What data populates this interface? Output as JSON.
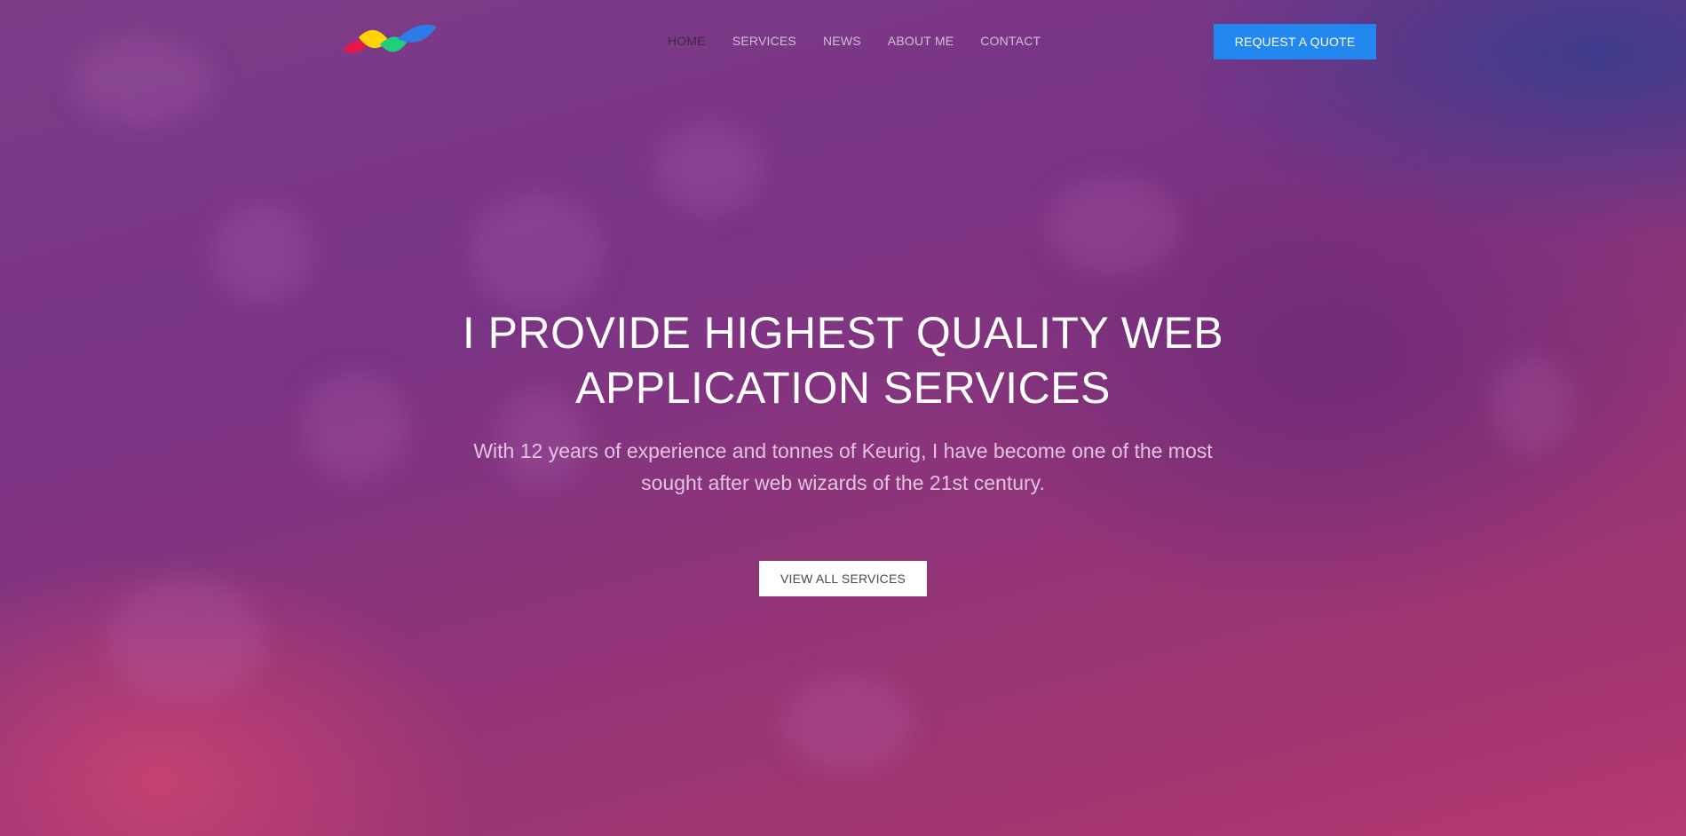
{
  "brand": {
    "logo_icon": "four-color-leaf-logo-icon",
    "logo_colors": [
      "#e8174b",
      "#ffd200",
      "#1fd07a",
      "#2f7be8"
    ]
  },
  "nav": {
    "items": [
      {
        "label": "HOME",
        "active": true
      },
      {
        "label": "SERVICES",
        "active": false
      },
      {
        "label": "NEWS",
        "active": false
      },
      {
        "label": "ABOUT ME",
        "active": false
      },
      {
        "label": "CONTACT",
        "active": false
      }
    ]
  },
  "header": {
    "quote_button_label": "REQUEST A QUOTE"
  },
  "hero": {
    "title_line1": "I PROVIDE HIGHEST QUALITY WEB",
    "title_line2": "APPLICATION SERVICES",
    "subtitle_line1": "With 12 years of experience and tonnes of Keurig, I have become one of the most",
    "subtitle_line2": "sought after web wizards of the 21st century.",
    "cta_label": "VIEW ALL SERVICES"
  },
  "colors": {
    "accent": "#2287ef",
    "background_top": "#7c3c88",
    "background_bottom": "#b53a6f"
  }
}
